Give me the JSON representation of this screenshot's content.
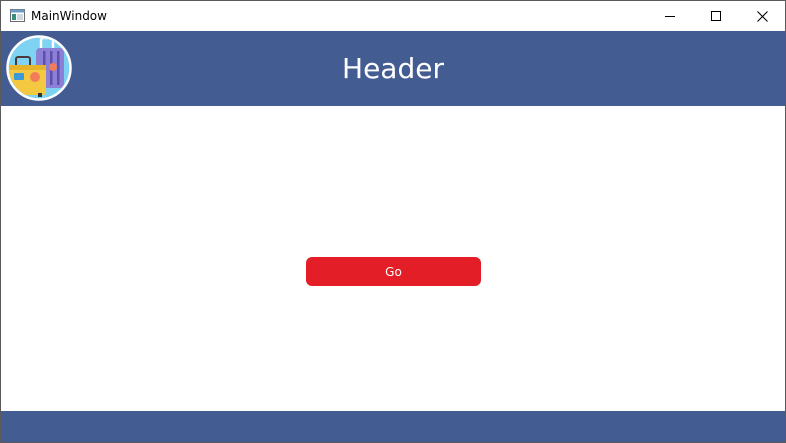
{
  "window": {
    "title": "MainWindow",
    "app_icon": "window-app-icon",
    "controls": {
      "minimize_icon": "minimize-icon",
      "maximize_icon": "maximize-icon",
      "close_icon": "close-icon"
    }
  },
  "header": {
    "title": "Header",
    "logo_icon": "suitcase-logo-icon",
    "background": "#435c92"
  },
  "main": {
    "go_button_label": "Go",
    "go_button_color": "#e31e26"
  },
  "footer": {
    "background": "#435c92"
  }
}
